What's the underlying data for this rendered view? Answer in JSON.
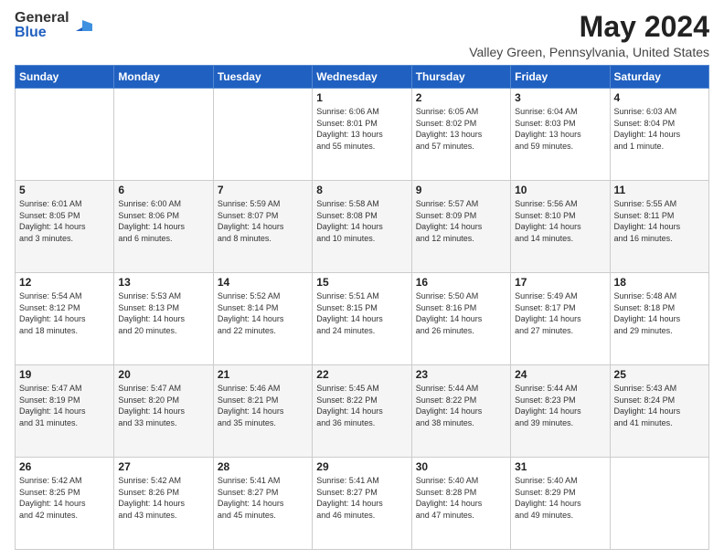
{
  "logo": {
    "general": "General",
    "blue": "Blue"
  },
  "title": "May 2024",
  "location": "Valley Green, Pennsylvania, United States",
  "days_header": [
    "Sunday",
    "Monday",
    "Tuesday",
    "Wednesday",
    "Thursday",
    "Friday",
    "Saturday"
  ],
  "weeks": [
    [
      {
        "day": "",
        "info": ""
      },
      {
        "day": "",
        "info": ""
      },
      {
        "day": "",
        "info": ""
      },
      {
        "day": "1",
        "info": "Sunrise: 6:06 AM\nSunset: 8:01 PM\nDaylight: 13 hours\nand 55 minutes."
      },
      {
        "day": "2",
        "info": "Sunrise: 6:05 AM\nSunset: 8:02 PM\nDaylight: 13 hours\nand 57 minutes."
      },
      {
        "day": "3",
        "info": "Sunrise: 6:04 AM\nSunset: 8:03 PM\nDaylight: 13 hours\nand 59 minutes."
      },
      {
        "day": "4",
        "info": "Sunrise: 6:03 AM\nSunset: 8:04 PM\nDaylight: 14 hours\nand 1 minute."
      }
    ],
    [
      {
        "day": "5",
        "info": "Sunrise: 6:01 AM\nSunset: 8:05 PM\nDaylight: 14 hours\nand 3 minutes."
      },
      {
        "day": "6",
        "info": "Sunrise: 6:00 AM\nSunset: 8:06 PM\nDaylight: 14 hours\nand 6 minutes."
      },
      {
        "day": "7",
        "info": "Sunrise: 5:59 AM\nSunset: 8:07 PM\nDaylight: 14 hours\nand 8 minutes."
      },
      {
        "day": "8",
        "info": "Sunrise: 5:58 AM\nSunset: 8:08 PM\nDaylight: 14 hours\nand 10 minutes."
      },
      {
        "day": "9",
        "info": "Sunrise: 5:57 AM\nSunset: 8:09 PM\nDaylight: 14 hours\nand 12 minutes."
      },
      {
        "day": "10",
        "info": "Sunrise: 5:56 AM\nSunset: 8:10 PM\nDaylight: 14 hours\nand 14 minutes."
      },
      {
        "day": "11",
        "info": "Sunrise: 5:55 AM\nSunset: 8:11 PM\nDaylight: 14 hours\nand 16 minutes."
      }
    ],
    [
      {
        "day": "12",
        "info": "Sunrise: 5:54 AM\nSunset: 8:12 PM\nDaylight: 14 hours\nand 18 minutes."
      },
      {
        "day": "13",
        "info": "Sunrise: 5:53 AM\nSunset: 8:13 PM\nDaylight: 14 hours\nand 20 minutes."
      },
      {
        "day": "14",
        "info": "Sunrise: 5:52 AM\nSunset: 8:14 PM\nDaylight: 14 hours\nand 22 minutes."
      },
      {
        "day": "15",
        "info": "Sunrise: 5:51 AM\nSunset: 8:15 PM\nDaylight: 14 hours\nand 24 minutes."
      },
      {
        "day": "16",
        "info": "Sunrise: 5:50 AM\nSunset: 8:16 PM\nDaylight: 14 hours\nand 26 minutes."
      },
      {
        "day": "17",
        "info": "Sunrise: 5:49 AM\nSunset: 8:17 PM\nDaylight: 14 hours\nand 27 minutes."
      },
      {
        "day": "18",
        "info": "Sunrise: 5:48 AM\nSunset: 8:18 PM\nDaylight: 14 hours\nand 29 minutes."
      }
    ],
    [
      {
        "day": "19",
        "info": "Sunrise: 5:47 AM\nSunset: 8:19 PM\nDaylight: 14 hours\nand 31 minutes."
      },
      {
        "day": "20",
        "info": "Sunrise: 5:47 AM\nSunset: 8:20 PM\nDaylight: 14 hours\nand 33 minutes."
      },
      {
        "day": "21",
        "info": "Sunrise: 5:46 AM\nSunset: 8:21 PM\nDaylight: 14 hours\nand 35 minutes."
      },
      {
        "day": "22",
        "info": "Sunrise: 5:45 AM\nSunset: 8:22 PM\nDaylight: 14 hours\nand 36 minutes."
      },
      {
        "day": "23",
        "info": "Sunrise: 5:44 AM\nSunset: 8:22 PM\nDaylight: 14 hours\nand 38 minutes."
      },
      {
        "day": "24",
        "info": "Sunrise: 5:44 AM\nSunset: 8:23 PM\nDaylight: 14 hours\nand 39 minutes."
      },
      {
        "day": "25",
        "info": "Sunrise: 5:43 AM\nSunset: 8:24 PM\nDaylight: 14 hours\nand 41 minutes."
      }
    ],
    [
      {
        "day": "26",
        "info": "Sunrise: 5:42 AM\nSunset: 8:25 PM\nDaylight: 14 hours\nand 42 minutes."
      },
      {
        "day": "27",
        "info": "Sunrise: 5:42 AM\nSunset: 8:26 PM\nDaylight: 14 hours\nand 43 minutes."
      },
      {
        "day": "28",
        "info": "Sunrise: 5:41 AM\nSunset: 8:27 PM\nDaylight: 14 hours\nand 45 minutes."
      },
      {
        "day": "29",
        "info": "Sunrise: 5:41 AM\nSunset: 8:27 PM\nDaylight: 14 hours\nand 46 minutes."
      },
      {
        "day": "30",
        "info": "Sunrise: 5:40 AM\nSunset: 8:28 PM\nDaylight: 14 hours\nand 47 minutes."
      },
      {
        "day": "31",
        "info": "Sunrise: 5:40 AM\nSunset: 8:29 PM\nDaylight: 14 hours\nand 49 minutes."
      },
      {
        "day": "",
        "info": ""
      }
    ]
  ]
}
